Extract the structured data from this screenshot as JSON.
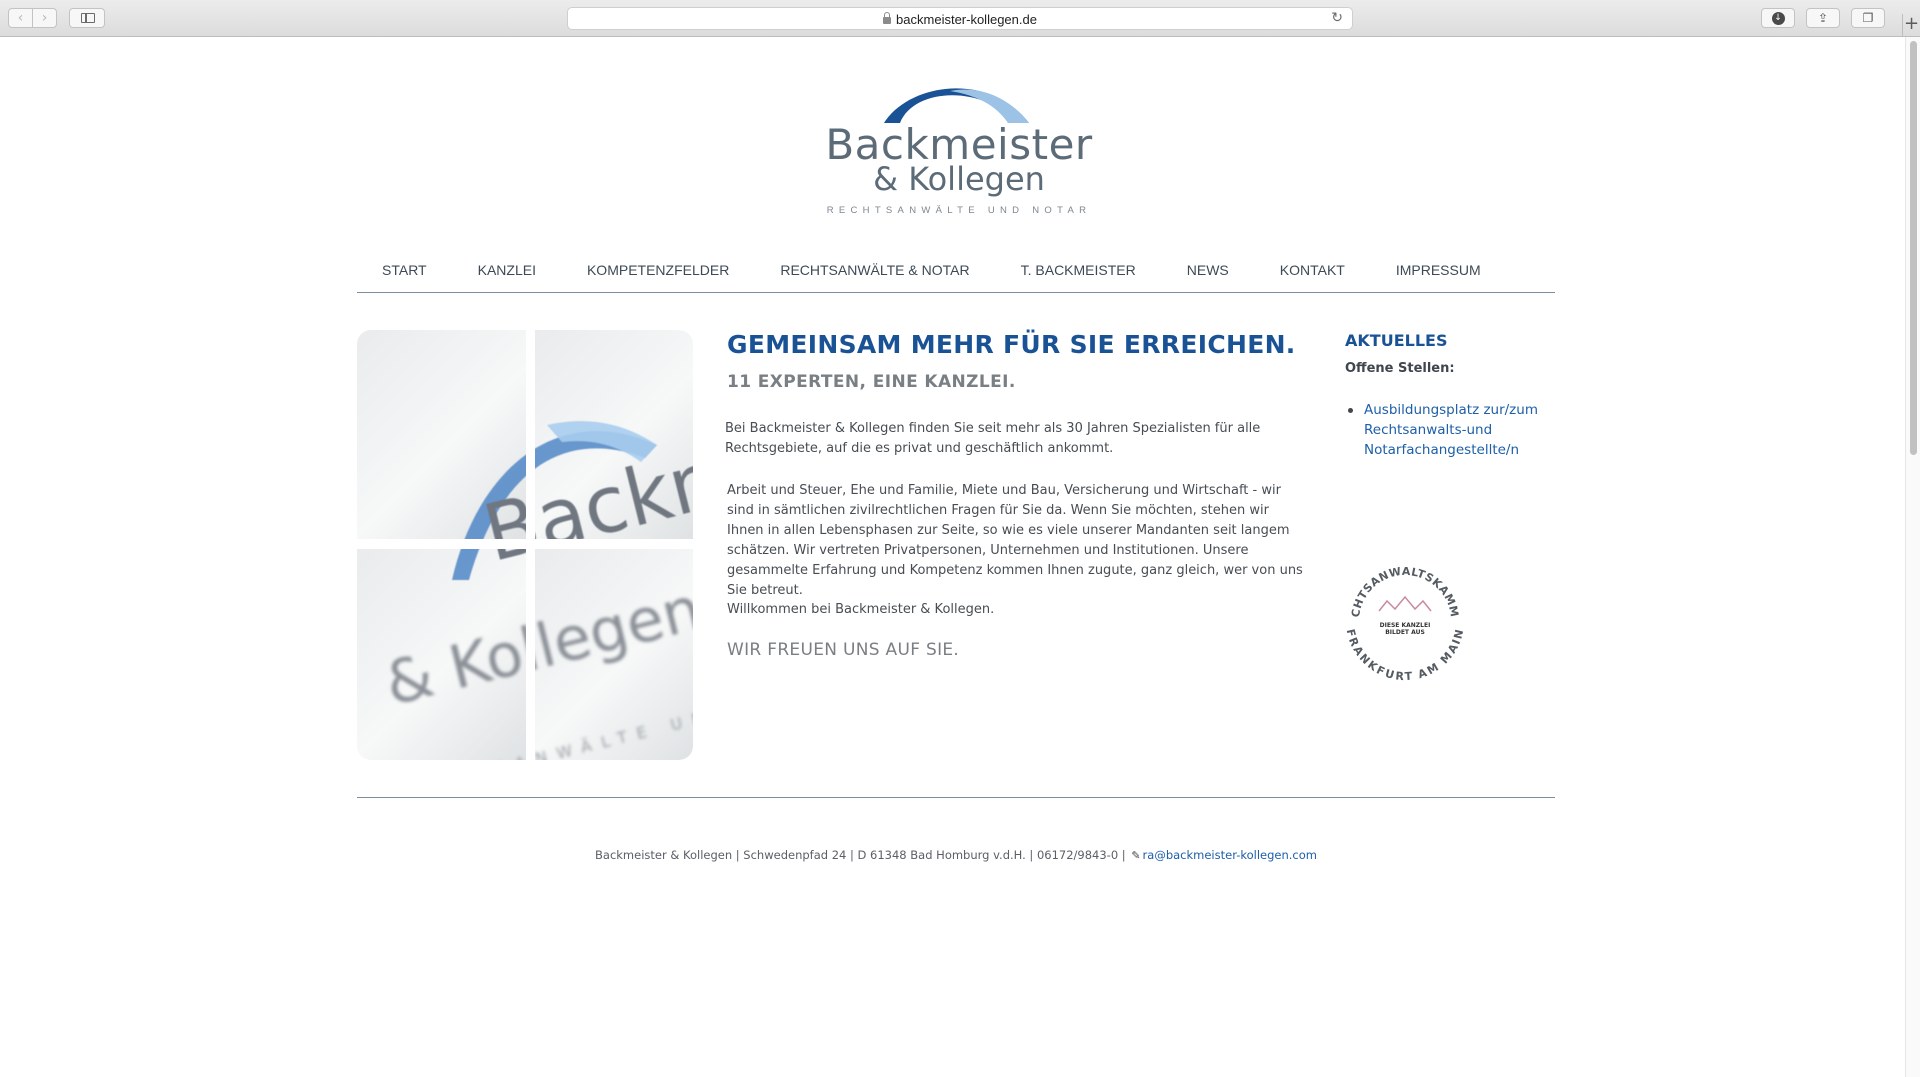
{
  "browser": {
    "url": "backmeister-kollegen.de",
    "back_icon": "chevron-left-icon",
    "forward_icon": "chevron-right-icon",
    "reload_icon": "reload-icon"
  },
  "logo": {
    "name_line1": "Backmeister",
    "name_line2": "& Kollegen",
    "tagline": "RECHTSANWÄLTE UND NOTAR",
    "colors": {
      "arc_dark": "#1a5296",
      "arc_light": "#9cc3e6",
      "text": "#5c6b78"
    }
  },
  "nav": {
    "items": [
      {
        "label": "START"
      },
      {
        "label": "KANZLEI"
      },
      {
        "label": "KOMPETENZFELDER"
      },
      {
        "label": "RECHTSANWÄLTE & NOTAR"
      },
      {
        "label": "T. BACKMEISTER"
      },
      {
        "label": "NEWS"
      },
      {
        "label": "KONTAKT"
      },
      {
        "label": "IMPRESSUM"
      }
    ]
  },
  "hero_image_text": {
    "line1": "Backmeister",
    "line2": "& Kollegen",
    "line3": "RECHTSANWÄLTE UND NOTAR"
  },
  "main": {
    "headline": "GEMEINSAM MEHR FÜR SIE ERREICHEN.",
    "subheadline": "11 EXPERTEN, EINE KANZLEI.",
    "paragraph1": "Bei Backmeister & Kollegen finden Sie seit mehr als 30 Jahren Spezialisten für alle Rechtsgebiete, auf die es privat und geschäftlich ankommt.",
    "paragraph2": "Arbeit und Steuer, Ehe und Familie, Miete und Bau, Versicherung und Wirtschaft -  wir sind in sämtlichen zivilrechtlichen Fragen für Sie da. Wenn Sie möchten, stehen wir Ihnen in allen Lebensphasen zur Seite, so wie es viele unserer Mandanten seit langem schätzen. Wir vertreten Privatpersonen, Unternehmen und Institutionen. Unsere gesammelte Erfahrung und Kompetenz kommen Ihnen zugute, ganz gleich, wer von uns Sie betreut.",
    "paragraph3": "Willkommen bei Backmeister & Kollegen.",
    "closing": "WIR FREUEN UNS AUF SIE."
  },
  "aside": {
    "title": "AKTUELLES",
    "subtitle": "Offene Stellen:",
    "jobs": [
      {
        "label": "Ausbildungsplatz zur/zum Rechtsanwalts-und Notarfachangestellte/n"
      }
    ],
    "seal": {
      "ring_top": "RECHTSANWALTSKAMMER",
      "ring_bottom": "FRANKFURT AM MAIN",
      "center_line1": "DIESE KANZLEI",
      "center_line2": "BILDET AUS"
    }
  },
  "footer": {
    "address": "Backmeister & Kollegen | Schwedenpfad 24 | D 61348 Bad Homburg v.d.H.  | 06172/9843-0 |",
    "email": "ra@backmeister-kollegen.com",
    "email_icon": "paperclip-icon"
  },
  "colors": {
    "brand_blue": "#1a5296",
    "link_blue": "#1d5fa8",
    "rule": "#7c8f9e"
  }
}
